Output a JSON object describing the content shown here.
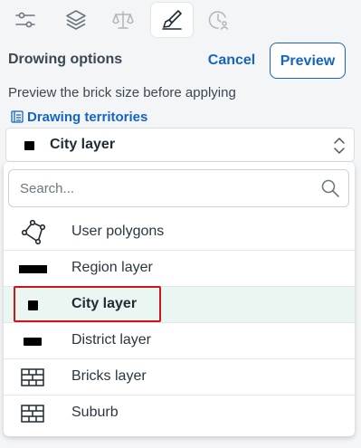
{
  "toolbar": {
    "tools": [
      {
        "icon": "sliders-icon"
      },
      {
        "icon": "layers-icon"
      },
      {
        "icon": "scale-icon"
      },
      {
        "icon": "brush-icon",
        "active": true
      },
      {
        "icon": "clock-user-icon"
      }
    ]
  },
  "header": {
    "title": "Drowing options",
    "cancel_label": "Cancel",
    "preview_label": "Preview"
  },
  "hint": "Preview the brick size before applying",
  "territories_link": "Drawing territories",
  "select": {
    "value": "City layer"
  },
  "dropdown": {
    "search_placeholder": "Search...",
    "items": [
      {
        "label": "User polygons",
        "icon": "polygon-icon"
      },
      {
        "label": "Region layer",
        "icon": "large-rect-icon"
      },
      {
        "label": "City layer",
        "icon": "small-square-icon",
        "selected": true
      },
      {
        "label": "District layer",
        "icon": "medium-rect-icon"
      },
      {
        "label": "Bricks layer",
        "icon": "bricks-icon"
      },
      {
        "label": "Suburb",
        "icon": "bricks-icon"
      }
    ]
  },
  "colors": {
    "accent": "#1565c0",
    "selected_row": "#e9f6f1",
    "highlight": "#d0121a"
  }
}
